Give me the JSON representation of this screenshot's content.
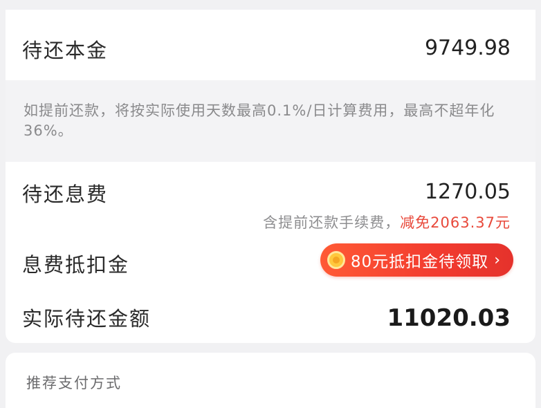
{
  "principal": {
    "label": "待还本金",
    "value": "9749.98"
  },
  "notice": {
    "text": "如提前还款，将按实际使用天数最高0.1%/日计算费用，最高不超年化36%。"
  },
  "interest": {
    "label": "待还息费",
    "value": "1270.05",
    "fee_note_prefix": "含提前还款手续费，",
    "fee_note_waiver": "减免2063.37元"
  },
  "coupon": {
    "label": "息费抵扣金",
    "button_label": "80元抵扣金待领取",
    "chevron": "›",
    "icon": "coin-icon"
  },
  "total": {
    "label": "实际待还金额",
    "value": "11020.03"
  },
  "payment": {
    "section_title": "推荐支付方式"
  },
  "colors": {
    "accent": "#f23b2f",
    "waiver_text": "#e8483a",
    "background": "#f1f1f3"
  }
}
